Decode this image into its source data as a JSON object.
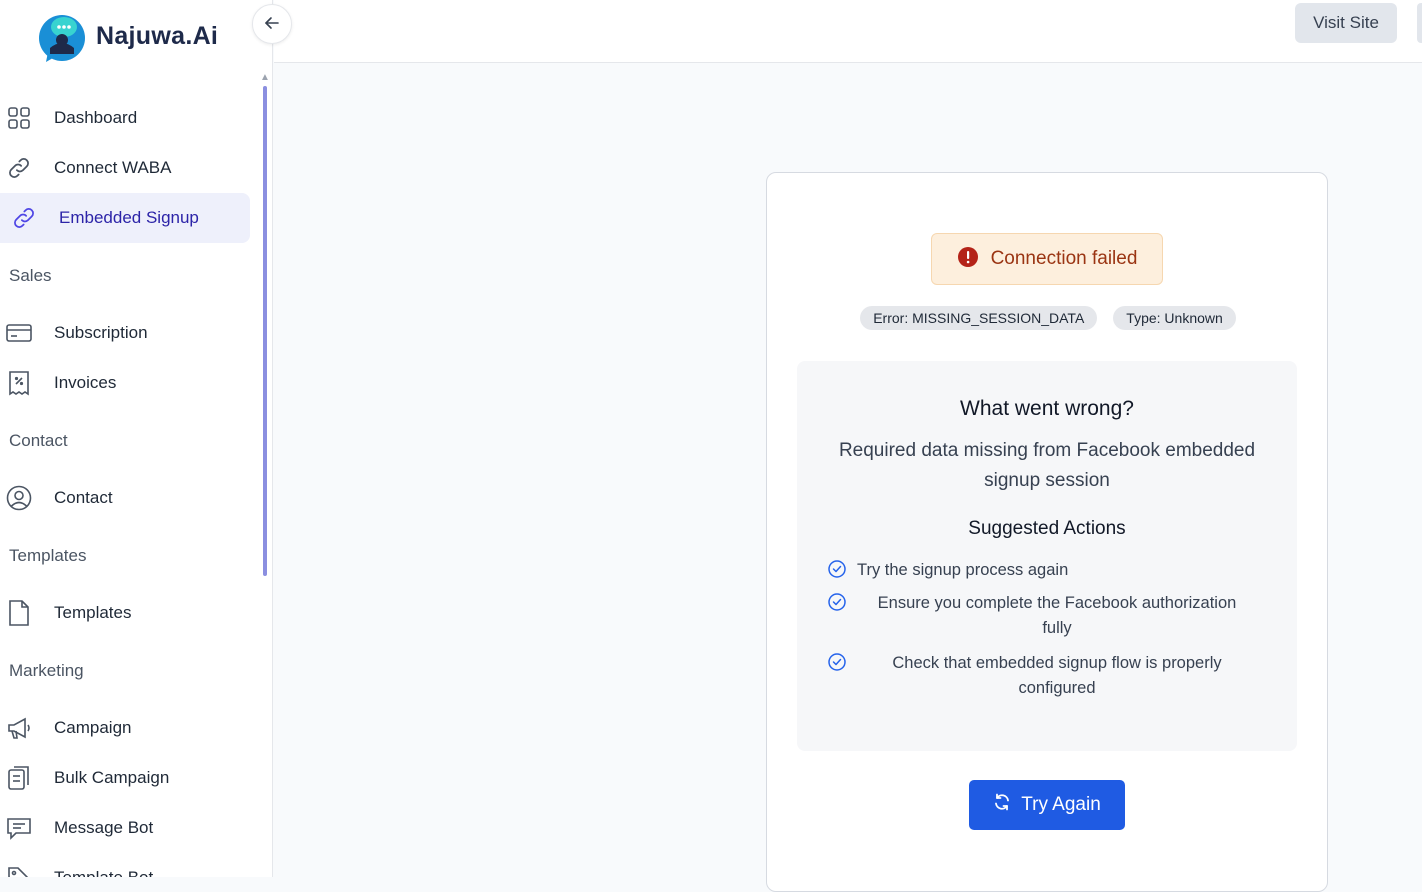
{
  "brand": {
    "name": "Najuwa.Ai"
  },
  "topbar": {
    "visit_site_label": "Visit Site"
  },
  "sidebar": {
    "items_top": [
      {
        "label": "Dashboard",
        "icon": "grid-icon"
      },
      {
        "label": "Connect WABA",
        "icon": "link-icon"
      },
      {
        "label": "Embedded Signup",
        "icon": "link-icon",
        "active": true
      }
    ],
    "sections": [
      {
        "title": "Sales",
        "items": [
          {
            "label": "Subscription",
            "icon": "credit-card-icon"
          },
          {
            "label": "Invoices",
            "icon": "receipt-icon"
          }
        ]
      },
      {
        "title": "Contact",
        "items": [
          {
            "label": "Contact",
            "icon": "user-circle-icon"
          }
        ]
      },
      {
        "title": "Templates",
        "items": [
          {
            "label": "Templates",
            "icon": "file-icon"
          }
        ]
      },
      {
        "title": "Marketing",
        "items": [
          {
            "label": "Campaign",
            "icon": "megaphone-icon"
          },
          {
            "label": "Bulk Campaign",
            "icon": "clipboard-icon"
          },
          {
            "label": "Message Bot",
            "icon": "message-icon"
          },
          {
            "label": "Template Bot",
            "icon": "tag-icon"
          }
        ]
      }
    ]
  },
  "card": {
    "alert_text": "Connection failed",
    "error_badge": "Error: MISSING_SESSION_DATA",
    "type_badge": "Type: Unknown",
    "panel_title": "What went wrong?",
    "panel_desc": "Required data missing from Facebook embedded signup session",
    "actions_title": "Suggested Actions",
    "actions": [
      "Try the signup process again",
      "Ensure you complete the Facebook authorization fully",
      "Check that embedded signup flow is properly configured"
    ],
    "try_again_label": "Try Again"
  },
  "colors": {
    "primary": "#1f5be3",
    "active_nav": "#2c24a8",
    "alert_bg": "#fdefdd",
    "alert_text": "#9a3412"
  }
}
